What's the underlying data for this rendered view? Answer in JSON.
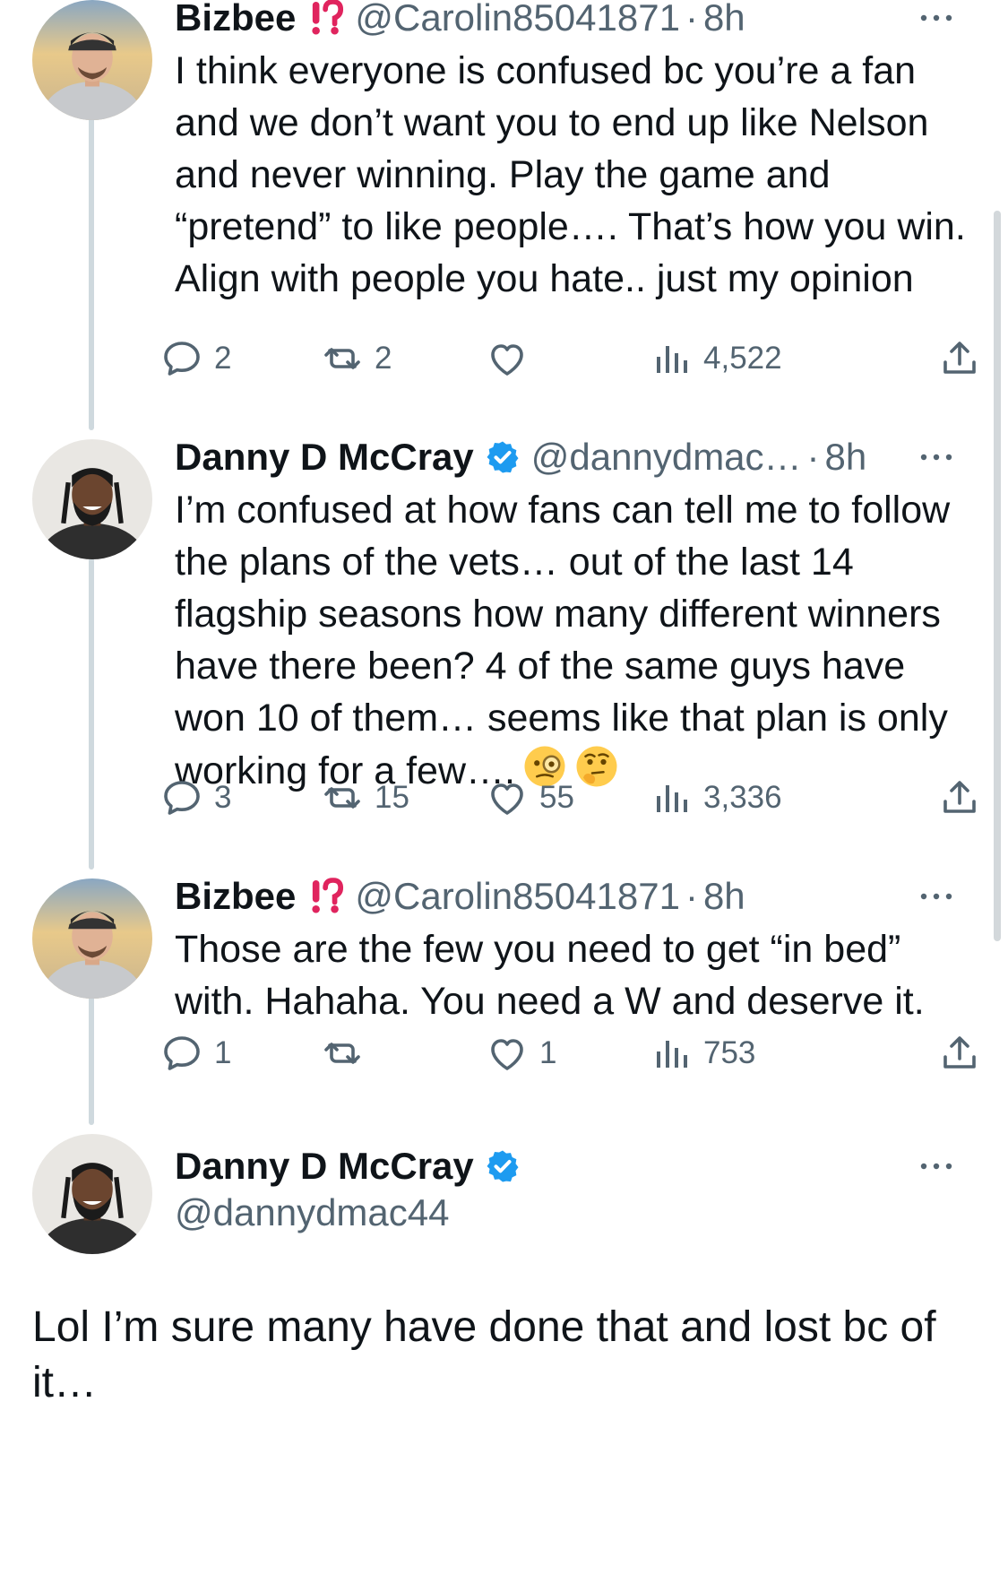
{
  "tweets": [
    {
      "name": "Bizbee",
      "badge": "⁉️",
      "handle": "@Carolin85041871",
      "time": "8h",
      "text": "I think everyone is confused bc you’re a fan and we don’t want you to end up like Nelson and never winning. Play the game and “pretend” to like people…. That’s how you win. Align with people you hate.. just my opinion",
      "replies": "2",
      "retweets": "2",
      "likes": "",
      "views": "4,522"
    },
    {
      "name": "Danny D McCray",
      "verified": true,
      "handle": "@dannydmac…",
      "time": "8h",
      "text": "I’m confused at how fans can tell me to follow the plans of the vets… out of the last 14 flagship seasons how many different winners have there been? 4 of the same guys have won 10 of them… seems like that plan is only working for a few….",
      "emojis": [
        "monocle-face",
        "thinking-face"
      ],
      "replies": "3",
      "retweets": "15",
      "likes": "55",
      "views": "3,336"
    },
    {
      "name": "Bizbee",
      "badge": "⁉️",
      "handle": "@Carolin85041871",
      "time": "8h",
      "text": "Those are the few you need to get “in bed” with. Hahaha. You need a W and deserve it.",
      "replies": "1",
      "retweets": "",
      "likes": "1",
      "views": "753"
    }
  ],
  "main_tweet": {
    "name": "Danny D McCray",
    "handle": "@dannydmac44",
    "text": "Lol I’m sure many have done that and lost bc of it…"
  },
  "colors": {
    "text": "#0f1419",
    "secondary": "#536471",
    "verified": "#1d9bf0",
    "badge": "#e0245e",
    "thread_line": "#cfd9de"
  },
  "icons": [
    "reply-icon",
    "retweet-icon",
    "like-icon",
    "views-icon",
    "share-icon",
    "more-icon",
    "verified-icon"
  ]
}
